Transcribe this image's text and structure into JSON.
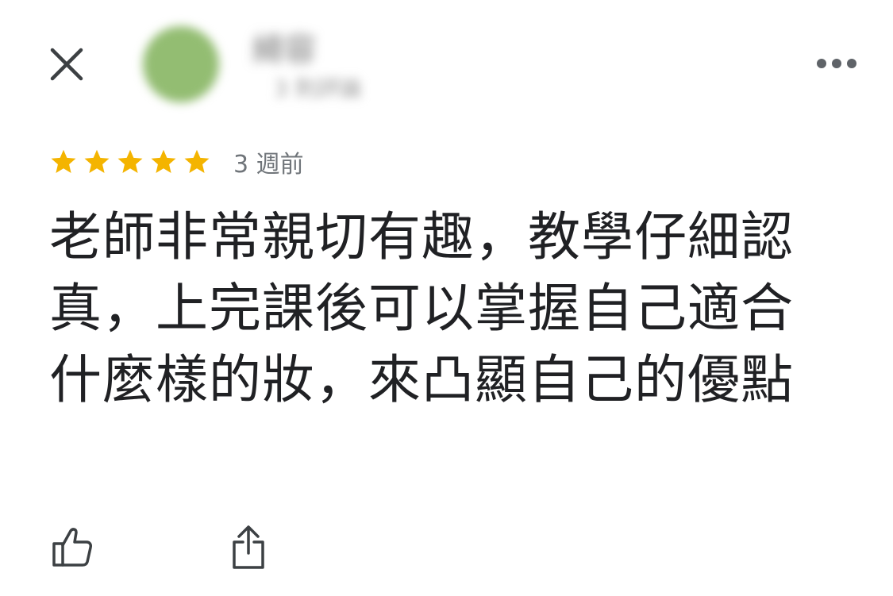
{
  "header": {
    "close_icon": "close-icon",
    "more_icon": "more-horizontal-icon",
    "reviewer_name": "綺容",
    "reviewer_meta": "3 則評論",
    "avatar_color": "#93bd72"
  },
  "review": {
    "rating": 5,
    "rating_max": 5,
    "star_color": "#f4b400",
    "timestamp": "3 週前",
    "text": "老師非常親切有趣，教學仔細認真，上完課後可以掌握自己適合什麼樣的妝，來凸顯自己的優點"
  },
  "actions": {
    "like_icon": "thumbs-up-icon",
    "share_icon": "share-icon"
  }
}
